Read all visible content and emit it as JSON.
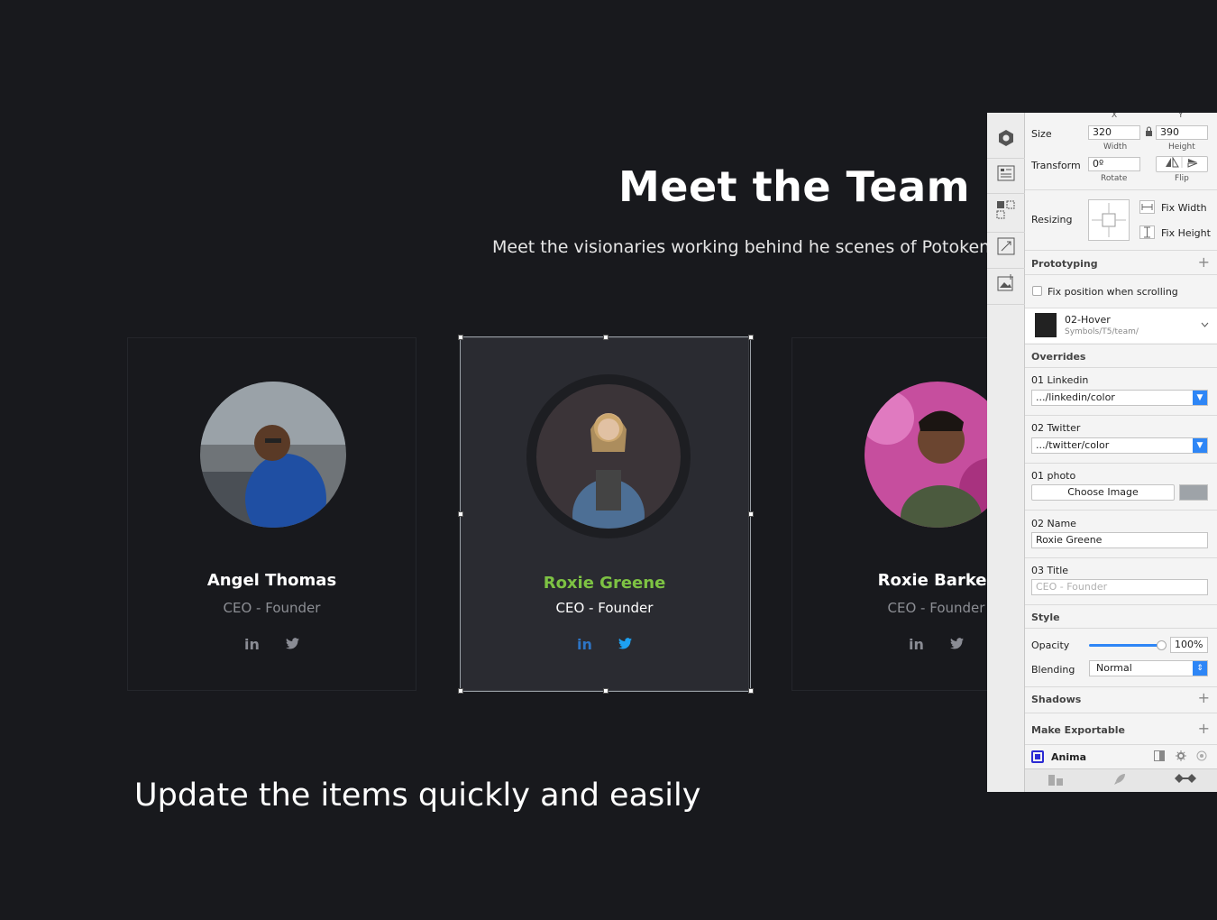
{
  "page": {
    "headline": "Meet the Team",
    "subline": "Meet the visionaries working behind he scenes of Potoken pl",
    "bottom_text": "Update the items quickly and easily"
  },
  "cards": [
    {
      "name": "Angel Thomas",
      "title": "CEO - Founder",
      "linkedin": "in",
      "twitter": "🐦"
    },
    {
      "name": "Roxie Greene",
      "title": "CEO - Founder",
      "linkedin": "in",
      "twitter": "🐦"
    },
    {
      "name": "Roxie Barker",
      "title": "CEO - Founder",
      "linkedin": "in",
      "twitter": "🐦"
    }
  ],
  "colors": {
    "background": "#18191d",
    "active_card": "#2a2b31",
    "active_name": "#7dc243",
    "linkedin": "#2d74c4",
    "twitter": "#1da1f2",
    "accent": "#2e86f6"
  },
  "inspector": {
    "x_label": "X",
    "y_label": "Y",
    "size_label": "Size",
    "width_value": "320",
    "height_value": "390",
    "width_label": "Width",
    "height_label": "Height",
    "transform_label": "Transform",
    "rotate_value": "0º",
    "rotate_label": "Rotate",
    "flip_label": "Flip",
    "resizing_label": "Resizing",
    "fix_width": "Fix Width",
    "fix_height": "Fix Height",
    "prototyping_label": "Prototyping",
    "fix_position": "Fix position when scrolling",
    "symbol_name": "02-Hover",
    "symbol_path": "Symbols/T5/team/",
    "overrides_label": "Overrides",
    "override_linkedin_label": "01 Linkedin",
    "override_linkedin_value": ".../linkedin/color",
    "override_twitter_label": "02 Twitter",
    "override_twitter_value": ".../twitter/color",
    "override_photo_label": "01 photo",
    "choose_image": "Choose Image",
    "override_name_label": "02 Name",
    "override_name_value": "Roxie Greene",
    "override_title_label": "03 Title",
    "override_title_placeholder": "CEO - Founder",
    "style_label": "Style",
    "opacity_label": "Opacity",
    "opacity_value": "100%",
    "opacity": 1.0,
    "blending_label": "Blending",
    "blending_value": "Normal",
    "shadows_label": "Shadows",
    "exportable_label": "Make Exportable",
    "anima_label": "Anima"
  },
  "icons": {
    "toolbar": [
      "symbol-icon",
      "layout-icon",
      "align-icon",
      "resize-icon",
      "image-icon"
    ]
  }
}
